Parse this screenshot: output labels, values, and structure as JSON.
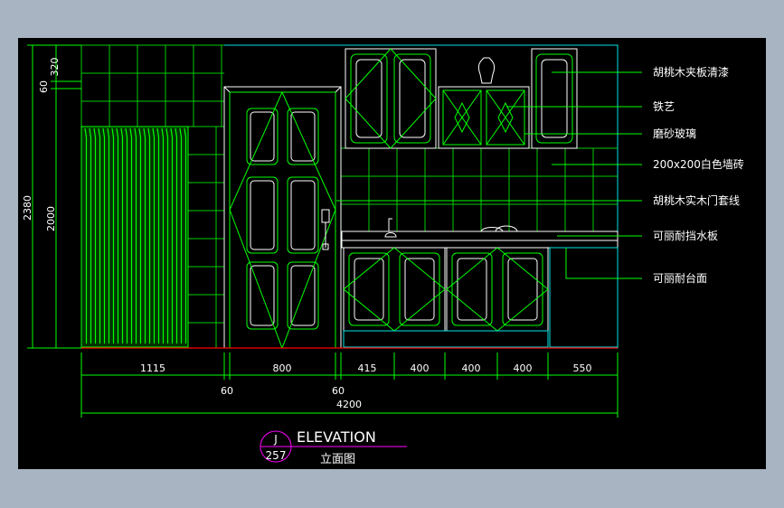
{
  "colors": {
    "background_outer": "#a8b4c2",
    "canvas": "#000000",
    "line_cyan": "#00e5e5",
    "line_green": "#00ff00",
    "line_white": "#ffffff",
    "line_red": "#ff0000",
    "line_magenta": "#ff00ff"
  },
  "dimensions": {
    "horizontal": [
      "1115",
      "800",
      "415",
      "400",
      "400",
      "400",
      "550"
    ],
    "gaps": [
      "60",
      "60"
    ],
    "total": "4200",
    "vertical": [
      "320",
      "60",
      "2380",
      "2000"
    ]
  },
  "annotations": [
    "胡桃木夹板清漆",
    "铁艺",
    "磨砂玻璃",
    "200x200白色墙砖",
    "胡桃木实木门套线",
    "可丽耐挡水板",
    "可丽耐台面"
  ],
  "title_block": {
    "detail_letter": "J",
    "sheet_number": "257",
    "title": "ELEVATION",
    "subtitle": "立面图"
  }
}
